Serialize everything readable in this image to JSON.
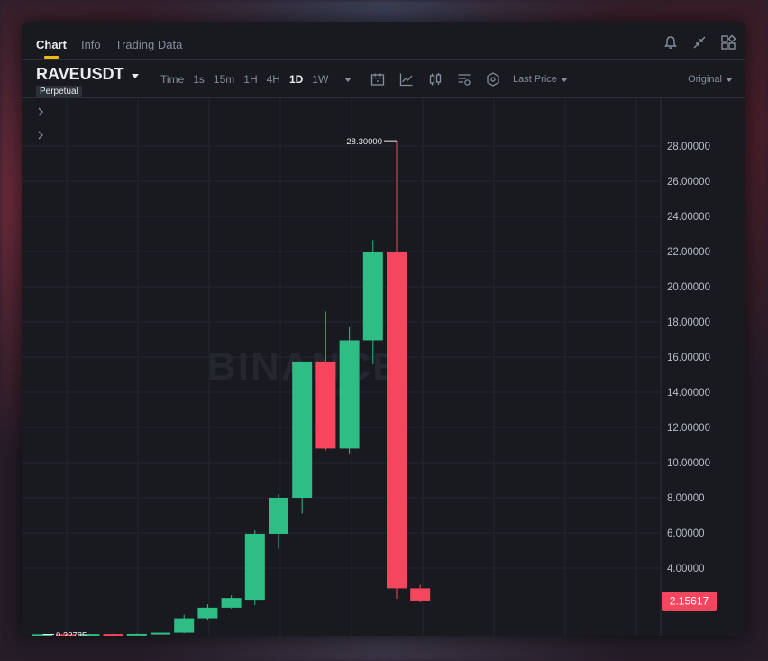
{
  "tabs": [
    {
      "label": "Chart",
      "active": true
    },
    {
      "label": "Info",
      "active": false
    },
    {
      "label": "Trading Data",
      "active": false
    }
  ],
  "header_icons": [
    "bell-icon",
    "collapse-icon",
    "layout-grid-icon"
  ],
  "symbol": "RAVEUSDT",
  "badge": "Perpetual",
  "intervals": [
    {
      "label": "Time",
      "active": false
    },
    {
      "label": "1s",
      "active": false
    },
    {
      "label": "15m",
      "active": false
    },
    {
      "label": "1H",
      "active": false
    },
    {
      "label": "4H",
      "active": false
    },
    {
      "label": "1D",
      "active": true
    },
    {
      "label": "1W",
      "active": false
    }
  ],
  "toolbar_icons": [
    "calendar-icon",
    "indicator-icon",
    "candle-type-icon",
    "settings-icon",
    "hexagon-icon"
  ],
  "price_type": "Last Price",
  "view_mode": "Original",
  "watermark": "BINANCE",
  "colors": {
    "up": "#2ebd85",
    "down": "#f6465d",
    "accent": "#f0b90b",
    "background": "#181a20",
    "grid": "#22262d",
    "axis_text": "#b7bdc6"
  },
  "chart_data": {
    "type": "candlestick",
    "title": "",
    "xlabel": "",
    "ylabel": "",
    "ylim": [
      0,
      29
    ],
    "y_ticks": [
      {
        "value": 4,
        "label": "4.00000"
      },
      {
        "value": 6,
        "label": "6.00000"
      },
      {
        "value": 8,
        "label": "8.00000"
      },
      {
        "value": 10,
        "label": "10.00000"
      },
      {
        "value": 12,
        "label": "12.00000"
      },
      {
        "value": 14,
        "label": "14.00000"
      },
      {
        "value": 16,
        "label": "16.00000"
      },
      {
        "value": 18,
        "label": "18.00000"
      },
      {
        "value": 20,
        "label": "20.00000"
      },
      {
        "value": 22,
        "label": "22.00000"
      },
      {
        "value": 24,
        "label": "24.00000"
      },
      {
        "value": 26,
        "label": "26.00000"
      },
      {
        "value": 28,
        "label": "28.00000"
      }
    ],
    "candles": [
      {
        "open": 0.23,
        "high": 0.26,
        "low": 0.22,
        "close": 0.24
      },
      {
        "open": 0.24,
        "high": 0.26,
        "low": 0.22,
        "close": 0.23
      },
      {
        "open": 0.23,
        "high": 0.27,
        "low": 0.22,
        "close": 0.25
      },
      {
        "open": 0.25,
        "high": 0.27,
        "low": 0.22,
        "close": 0.23
      },
      {
        "open": 0.23,
        "high": 0.28,
        "low": 0.22,
        "close": 0.26
      },
      {
        "open": 0.26,
        "high": 0.34,
        "low": 0.24,
        "close": 0.33
      },
      {
        "open": 0.33,
        "high": 1.35,
        "low": 0.3,
        "close": 1.15
      },
      {
        "open": 1.15,
        "high": 1.95,
        "low": 1.05,
        "close": 1.75
      },
      {
        "open": 1.75,
        "high": 2.45,
        "low": 1.7,
        "close": 2.3
      },
      {
        "open": 2.2,
        "high": 6.15,
        "low": 1.9,
        "close": 5.95
      },
      {
        "open": 5.95,
        "high": 8.2,
        "low": 5.1,
        "close": 8.0
      },
      {
        "open": 8.0,
        "high": 12.6,
        "low": 7.1,
        "close": 15.75
      },
      {
        "open": 15.75,
        "high": 18.6,
        "low": 10.7,
        "close": 10.8
      },
      {
        "open": 10.8,
        "high": 17.7,
        "low": 10.5,
        "close": 16.95
      },
      {
        "open": 16.95,
        "high": 22.65,
        "low": 15.6,
        "close": 21.95
      },
      {
        "open": 21.95,
        "high": 28.3,
        "low": 2.25,
        "close": 2.85
      },
      {
        "open": 2.85,
        "high": 3.05,
        "low": 2.05,
        "close": 2.15617
      }
    ],
    "annotations": {
      "max_label": "28.30000",
      "max_value": 28.3,
      "min_label": "0.22785",
      "min_value": 0.22785,
      "last_price_label": "2.15617",
      "last_price": 2.15617
    }
  }
}
